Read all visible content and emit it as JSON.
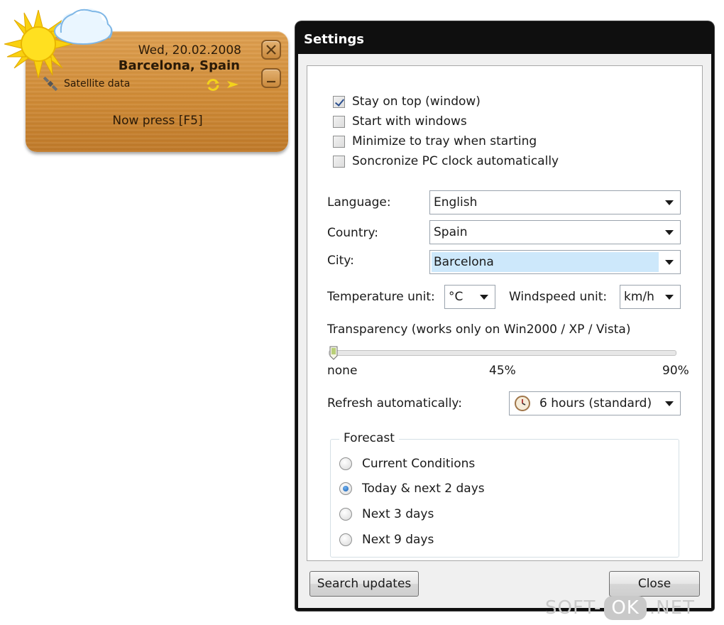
{
  "widget": {
    "date": "Wed, 20.02.2008",
    "city": "Barcelona, Spain",
    "satellite_label": "Satellite data",
    "press_hint": "Now press [F5]",
    "icons": [
      "sun-icon",
      "cloud-icon",
      "satellite-icon",
      "refresh-icon",
      "arrow-right-icon",
      "close-icon",
      "minimize-icon"
    ]
  },
  "settings": {
    "title": "Settings",
    "checkboxes": [
      {
        "label": "Stay on top (window)",
        "checked": true
      },
      {
        "label": "Start with windows",
        "checked": false
      },
      {
        "label": "Minimize to tray when starting",
        "checked": false
      },
      {
        "label": "Soncronize PC clock automatically",
        "checked": false
      }
    ],
    "language": {
      "label": "Language:",
      "value": "English"
    },
    "country": {
      "label": "Country:",
      "value": "Spain"
    },
    "city": {
      "label": "City:",
      "value": "Barcelona"
    },
    "temperature": {
      "label": "Temperature unit:",
      "value": "°C"
    },
    "windspeed": {
      "label": "Windspeed unit:",
      "value": "km/h"
    },
    "transparency": {
      "label": "Transparency (works only on Win2000 / XP / Vista)",
      "ticks": [
        "none",
        "45%",
        "90%"
      ],
      "value_percent": 0
    },
    "refresh": {
      "label": "Refresh automatically:",
      "value": "6 hours (standard)"
    },
    "forecast": {
      "legend": "Forecast",
      "options": [
        {
          "label": "Current Conditions",
          "selected": false
        },
        {
          "label": "Today & next 2 days",
          "selected": true
        },
        {
          "label": "Next 3 days",
          "selected": false
        },
        {
          "label": "Next 9 days",
          "selected": false
        }
      ]
    },
    "buttons": {
      "search_updates": "Search updates",
      "close": "Close"
    }
  },
  "watermark": {
    "left": "SOFT-",
    "ok": "OK",
    "right": ".NET"
  },
  "colors": {
    "widget_wood": "#d08b36",
    "titlebar": "#0f0f0f",
    "selection": "#cde8fb"
  }
}
